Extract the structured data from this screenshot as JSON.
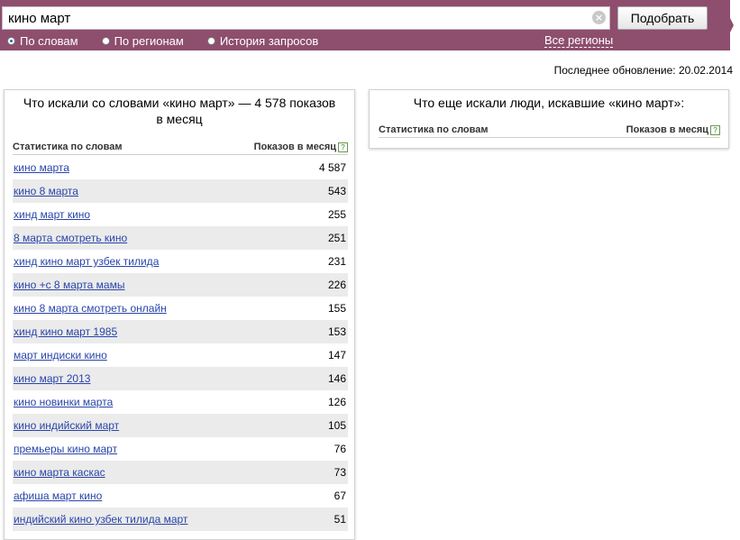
{
  "search": {
    "value": "кино март",
    "clear_glyph": "×",
    "submit_label": "Подобрать"
  },
  "radios": [
    {
      "label": "По словам",
      "checked": true
    },
    {
      "label": "По регионам",
      "checked": false
    },
    {
      "label": "История запросов",
      "checked": false
    }
  ],
  "regions_link": "Все регионы",
  "last_update": "Последнее обновление: 20.02.2014",
  "left_panel": {
    "title": "Что искали со словами «кино март» — 4 578 показов в месяц",
    "col_left": "Статистика по словам",
    "col_right": "Показов в месяц",
    "help_glyph": "?",
    "rows": [
      {
        "phrase": "кино марта",
        "count": "4 587"
      },
      {
        "phrase": "кино 8 марта",
        "count": "543"
      },
      {
        "phrase": "хинд март кино",
        "count": "255"
      },
      {
        "phrase": "8 марта смотреть кино",
        "count": "251"
      },
      {
        "phrase": "хинд кино март узбек тилида",
        "count": "231"
      },
      {
        "phrase": "кино +с 8 марта мамы",
        "count": "226"
      },
      {
        "phrase": "кино 8 марта смотреть онлайн",
        "count": "155"
      },
      {
        "phrase": "хинд кино март 1985",
        "count": "153"
      },
      {
        "phrase": "март индиски кино",
        "count": "147"
      },
      {
        "phrase": "кино март 2013",
        "count": "146"
      },
      {
        "phrase": "кино новинки марта",
        "count": "126"
      },
      {
        "phrase": "кино индийский март",
        "count": "105"
      },
      {
        "phrase": "премьеры кино март",
        "count": "76"
      },
      {
        "phrase": "кино марта каскас",
        "count": "73"
      },
      {
        "phrase": "афиша март кино",
        "count": "67"
      },
      {
        "phrase": "индийский кино узбек тилида март",
        "count": "51"
      }
    ]
  },
  "right_panel": {
    "title": "Что еще искали люди, искавшие «кино март»:",
    "col_left": "Статистика по словам",
    "col_right": "Показов в месяц",
    "help_glyph": "?"
  }
}
